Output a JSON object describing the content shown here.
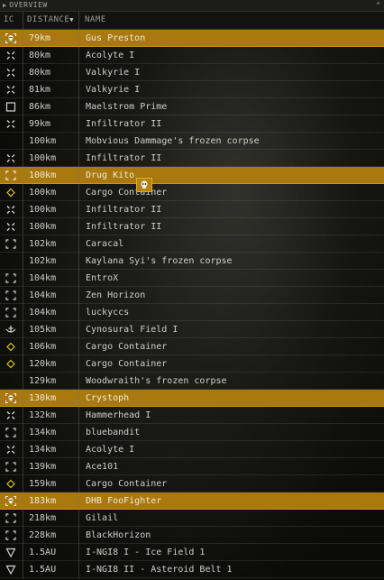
{
  "window": {
    "title": "OVERVIEW"
  },
  "columns": {
    "icon": "IC",
    "distance": "DISTANCE",
    "name": "NAME"
  },
  "rows": [
    {
      "icon": "bracket-skull-icon",
      "distance": "79km",
      "name": "Gus Preston",
      "selected": true
    },
    {
      "icon": "x-mark-icon",
      "distance": "80km",
      "name": "Acolyte I",
      "selected": false
    },
    {
      "icon": "x-mark-icon",
      "distance": "80km",
      "name": "Valkyrie I",
      "selected": false
    },
    {
      "icon": "x-mark-icon",
      "distance": "81km",
      "name": "Valkyrie I",
      "selected": false
    },
    {
      "icon": "square-icon",
      "distance": "86km",
      "name": "Maelstrom Prime",
      "selected": false
    },
    {
      "icon": "x-mark-icon",
      "distance": "99km",
      "name": "Infiltrator II",
      "selected": false
    },
    {
      "icon": "none",
      "distance": "100km",
      "name": "Mobvious Dammage's frozen corpse",
      "selected": false
    },
    {
      "icon": "x-mark-icon",
      "distance": "100km",
      "name": "Infiltrator II",
      "selected": false
    },
    {
      "icon": "bracket-icon",
      "distance": "100km",
      "name": "Drug Kito",
      "selected": true
    },
    {
      "icon": "diamond-icon",
      "distance": "100km",
      "name": "Cargo Container",
      "selected": false
    },
    {
      "icon": "x-mark-icon",
      "distance": "100km",
      "name": "Infiltrator II",
      "selected": false
    },
    {
      "icon": "x-mark-icon",
      "distance": "100km",
      "name": "Infiltrator II",
      "selected": false
    },
    {
      "icon": "bracket-icon",
      "distance": "102km",
      "name": "Caracal",
      "selected": false
    },
    {
      "icon": "none",
      "distance": "102km",
      "name": "Kaylana Syi's frozen corpse",
      "selected": false
    },
    {
      "icon": "bracket-icon",
      "distance": "104km",
      "name": "EntroX",
      "selected": false
    },
    {
      "icon": "bracket-icon",
      "distance": "104km",
      "name": "Zen Horizon",
      "selected": false
    },
    {
      "icon": "bracket-icon",
      "distance": "104km",
      "name": "luckyccs",
      "selected": false
    },
    {
      "icon": "anchor-icon",
      "distance": "105km",
      "name": "Cynosural Field I",
      "selected": false
    },
    {
      "icon": "diamond-icon",
      "distance": "106km",
      "name": "Cargo Container",
      "selected": false
    },
    {
      "icon": "diamond-icon",
      "distance": "120km",
      "name": "Cargo Container",
      "selected": false
    },
    {
      "icon": "none",
      "distance": "129km",
      "name": "Woodwraith's frozen corpse",
      "selected": false
    },
    {
      "icon": "bracket-skull-icon",
      "distance": "130km",
      "name": "Crystoph",
      "selected": true
    },
    {
      "icon": "x-mark-icon",
      "distance": "132km",
      "name": "Hammerhead I",
      "selected": false
    },
    {
      "icon": "bracket-icon",
      "distance": "134km",
      "name": "bluebandit",
      "selected": false
    },
    {
      "icon": "x-mark-icon",
      "distance": "134km",
      "name": "Acolyte I",
      "selected": false
    },
    {
      "icon": "bracket-icon",
      "distance": "139km",
      "name": "Ace101",
      "selected": false
    },
    {
      "icon": "diamond-icon",
      "distance": "159km",
      "name": "Cargo Container",
      "selected": false
    },
    {
      "icon": "bracket-skull-icon",
      "distance": "183km",
      "name": "DHB FooFighter",
      "selected": true
    },
    {
      "icon": "bracket-icon",
      "distance": "218km",
      "name": "Gilail",
      "selected": false
    },
    {
      "icon": "bracket-icon",
      "distance": "228km",
      "name": "BlackHorizon",
      "selected": false
    },
    {
      "icon": "triangle-icon",
      "distance": "1.5AU",
      "name": "I-NGI8 I - Ice Field 1",
      "selected": false
    },
    {
      "icon": "triangle-icon",
      "distance": "1.5AU",
      "name": "I-NGI8 II - Asteroid Belt 1",
      "selected": false
    }
  ],
  "colors": {
    "selected_row": "#a9780f",
    "diamond_icon": "#d8c21a"
  }
}
